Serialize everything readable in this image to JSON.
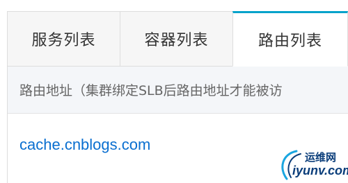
{
  "tabs": [
    {
      "label": "服务列表",
      "active": false
    },
    {
      "label": "容器列表",
      "active": false
    },
    {
      "label": "路由列表",
      "active": true
    }
  ],
  "table": {
    "header": "路由地址（集群绑定SLB后路由地址才能被访",
    "rows": [
      {
        "route": "cache.cnblogs.com"
      }
    ]
  },
  "watermark": {
    "line1": "运维网",
    "line2": "iyunv.com"
  },
  "colors": {
    "active_tab_border": "#00a2ca",
    "link": "#0a6fd0"
  }
}
